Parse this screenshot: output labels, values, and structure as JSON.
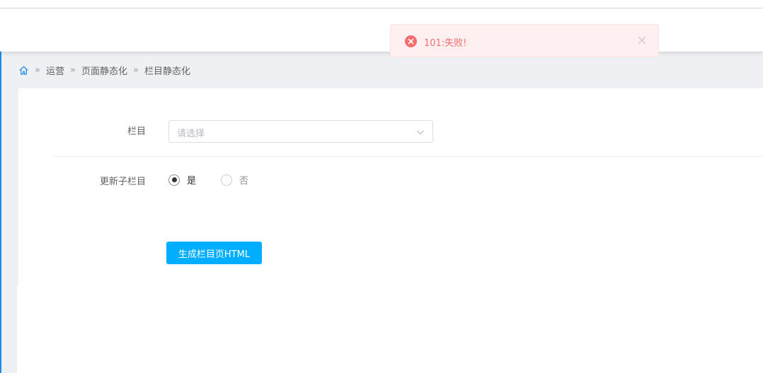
{
  "bookmarks": [],
  "breadcrumb": {
    "items": [
      "运营",
      "页面静态化",
      "栏目静态化"
    ]
  },
  "form": {
    "column": {
      "label": "栏目",
      "placeholder": "请选择"
    },
    "update_children": {
      "label": "更新子栏目",
      "options": [
        {
          "label": "是",
          "checked": true
        },
        {
          "label": "否",
          "checked": false
        }
      ]
    },
    "submit_label": "生成栏目页HTML"
  },
  "toast": {
    "type": "error",
    "message": "101:失败!"
  },
  "colors": {
    "primary_button": "#00aeff",
    "error_text": "#f56c6c",
    "error_bg": "#fef0f0",
    "accent_edge": "#1e88e5"
  }
}
